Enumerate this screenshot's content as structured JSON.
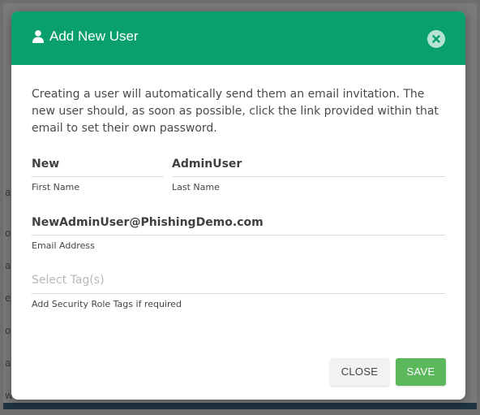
{
  "modal": {
    "title": "Add New User",
    "header_color": "#0aa06e",
    "title_icon": "user-icon",
    "close_icon": "close-circle-icon",
    "intro_text": "Creating a user will automatically send them an email invitation. The new user should, as soon as possible, click the link provided within that email to set their own password.",
    "fields": {
      "first_name": {
        "value": "New",
        "label": "First Name"
      },
      "last_name": {
        "value": "AdminUser",
        "label": "Last Name"
      },
      "email": {
        "value": "NewAdminUser@PhishingDemo.com",
        "label": "Email Address"
      },
      "tags": {
        "placeholder": "Select Tag(s)",
        "label": "Add Security Role Tags if required"
      }
    },
    "buttons": {
      "close_label": "CLOSE",
      "save_label": "SAVE",
      "save_color": "#5cb85c"
    }
  },
  "background": {
    "fragments": [
      "a",
      "o",
      "a.",
      "e",
      "os",
      "a",
      "w"
    ]
  }
}
